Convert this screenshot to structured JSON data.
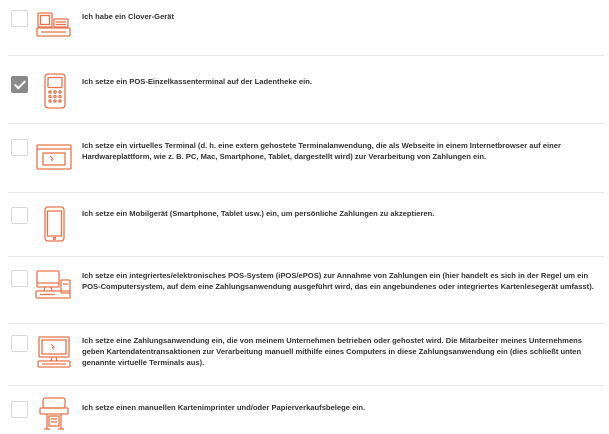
{
  "icon_color": "#e8734a",
  "options": [
    {
      "icon": "clover-register-icon",
      "checked": false,
      "label": "Ich habe ein Clover-Gerät"
    },
    {
      "icon": "pos-terminal-icon",
      "checked": true,
      "label": "Ich setze ein POS-Einzelkassenterminal auf der Ladentheke ein."
    },
    {
      "icon": "virtual-terminal-icon",
      "checked": false,
      "label": "Ich setze ein virtuelles Terminal (d. h. eine extern gehostete Terminalanwendung, die als Webseite in einem Internetbrowser auf einer Hardwareplattform, wie z. B. PC, Mac, Smartphone, Tablet, dargestellt wird) zur Verarbeitung von Zahlungen ein."
    },
    {
      "icon": "mobile-device-icon",
      "checked": false,
      "label": "Ich setze ein Mobilgerät (Smartphone, Tablet usw.) ein, um persönliche Zahlungen zu akzeptieren."
    },
    {
      "icon": "ipos-system-icon",
      "checked": false,
      "label": "Ich setze ein integriertes/elektronisches POS-System (iPOS/ePOS) zur Annahme von Zahlungen ein (hier handelt es sich in der Regel um ein POS-Computersystem, auf dem eine Zahlungsanwendung ausgeführt wird, das ein angebundenes oder integriertes Kartenlesegerät umfasst)."
    },
    {
      "icon": "payment-application-icon",
      "checked": false,
      "label": "Ich setze eine Zahlungsanwendung ein, die von meinem Unternehmen betrieben oder gehostet wird. Die Mitarbeiter meines Unternehmens geben Kartendatentransaktionen zur Verarbeitung manuell mithilfe eines Computers in diese Zahlungsanwendung ein (dies schließt unten genannte virtuelle Terminals aus)."
    },
    {
      "icon": "card-imprinter-icon",
      "checked": false,
      "label": "Ich setze einen manuellen Kartenimprinter und/oder Papierverkaufsbelege ein."
    }
  ]
}
